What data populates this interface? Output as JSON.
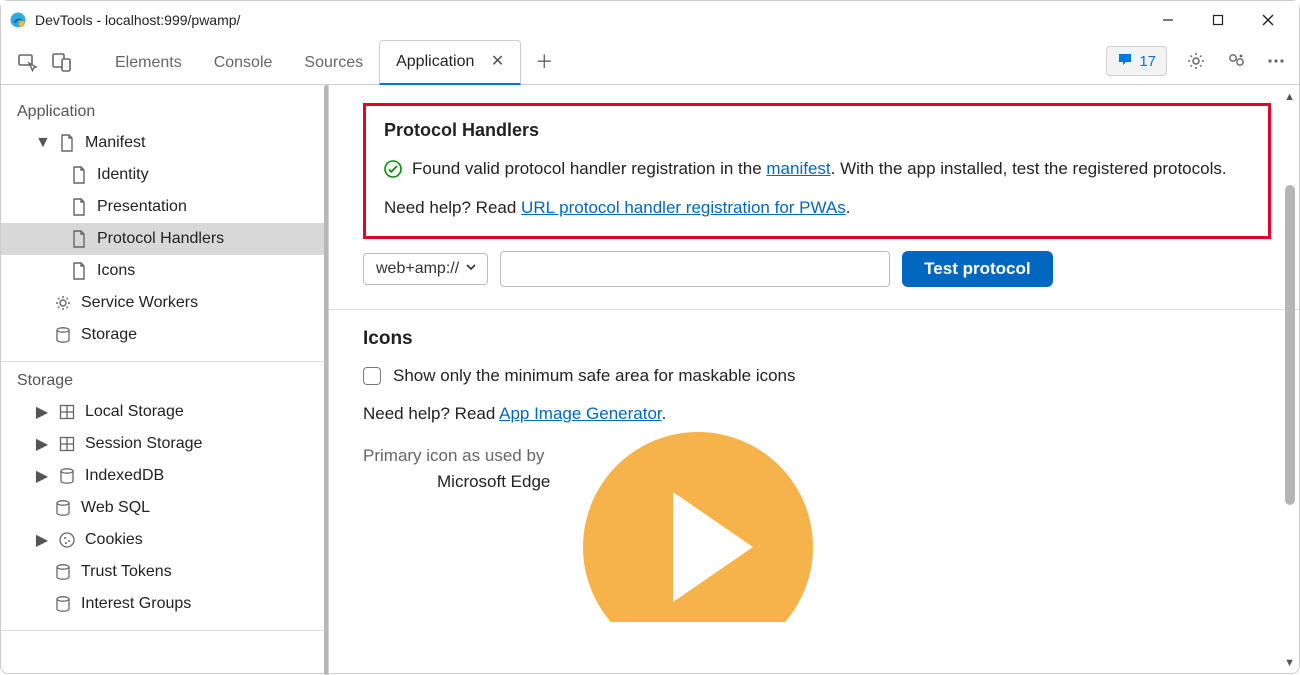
{
  "window": {
    "title": "DevTools - localhost:999/pwamp/"
  },
  "tabs": {
    "items": [
      "Elements",
      "Console",
      "Sources",
      "Application"
    ],
    "active_index": 3
  },
  "toolbar": {
    "feedback_count": "17"
  },
  "sidebar": {
    "application": {
      "title": "Application",
      "manifest": "Manifest",
      "identity": "Identity",
      "presentation": "Presentation",
      "protocol_handlers": "Protocol Handlers",
      "icons": "Icons",
      "service_workers": "Service Workers",
      "storage_item": "Storage"
    },
    "storage": {
      "title": "Storage",
      "local_storage": "Local Storage",
      "session_storage": "Session Storage",
      "indexeddb": "IndexedDB",
      "web_sql": "Web SQL",
      "cookies": "Cookies",
      "trust_tokens": "Trust Tokens",
      "interest_groups": "Interest Groups"
    }
  },
  "content": {
    "protocol_handlers": {
      "heading": "Protocol Handlers",
      "info_pre": "Found valid protocol handler registration in the ",
      "manifest_link": "manifest",
      "info_post": ". With the app installed, test the registered protocols.",
      "help_pre": "Need help? Read ",
      "help_link": "URL protocol handler registration for PWAs",
      "help_dot": "."
    },
    "controls": {
      "protocol_selected": "web+amp://",
      "input_value": "",
      "button_label": "Test protocol"
    },
    "icons": {
      "heading": "Icons",
      "checkbox_label": "Show only the minimum safe area for maskable icons",
      "help_pre": "Need help? Read ",
      "help_link": "App Image Generator",
      "help_dot": ".",
      "primary_label": "Primary icon as used by",
      "edge_label": "Microsoft Edge"
    }
  }
}
